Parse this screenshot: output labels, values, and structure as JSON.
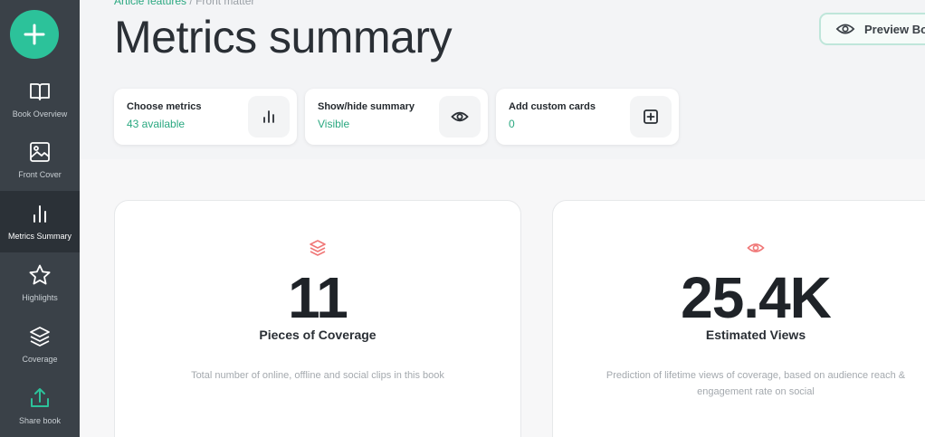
{
  "sidebar": {
    "items": [
      {
        "label": "Book Overview",
        "icon": "book-icon"
      },
      {
        "label": "Front Cover",
        "icon": "image-icon"
      },
      {
        "label": "Metrics Summary",
        "icon": "bar-chart-icon",
        "active": true
      },
      {
        "label": "Highlights",
        "icon": "star-icon"
      },
      {
        "label": "Coverage",
        "icon": "layers-icon"
      },
      {
        "label": "Share book",
        "icon": "share-icon"
      }
    ]
  },
  "header": {
    "breadcrumb": {
      "link": "Article features",
      "separator": " / ",
      "current": "Front matter"
    },
    "title": "Metrics summary",
    "preview_label": "Preview Bo"
  },
  "actions": [
    {
      "title": "Choose metrics",
      "value": "43 available",
      "icon": "bar-chart-icon"
    },
    {
      "title": "Show/hide summary",
      "value": "Visible",
      "icon": "eye-icon"
    },
    {
      "title": "Add custom cards",
      "value": "0",
      "icon": "plus-square-icon"
    }
  ],
  "metrics": [
    {
      "value": "11",
      "label": "Pieces of Coverage",
      "description": "Total number of online, offline and social clips in this book",
      "icon": "layers-icon"
    },
    {
      "value": "25.4K",
      "label": "Estimated Views",
      "description": "Prediction of lifetime views of coverage, based on audience reach & engagement rate on social",
      "icon": "eye-icon"
    }
  ],
  "colors": {
    "accent": "#2cc29a",
    "accent_text": "#2aa880",
    "sidebar": "#3a4148",
    "metric_icon": "#f07878"
  }
}
